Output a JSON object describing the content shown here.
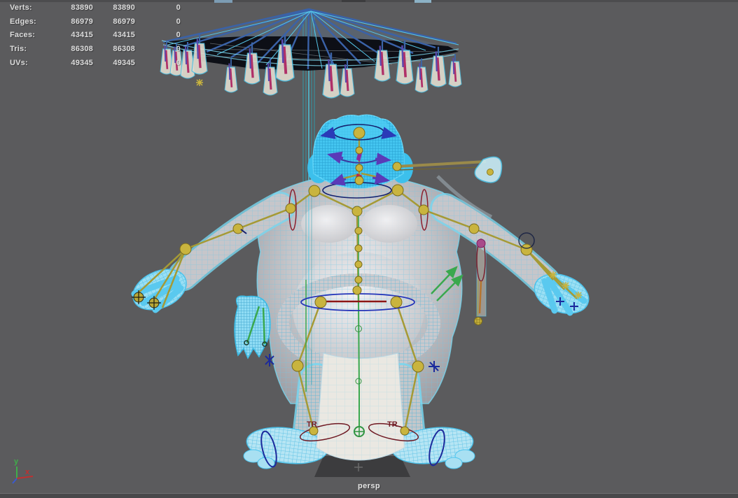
{
  "app": {
    "viewport_camera_label": "persp"
  },
  "hud": {
    "rows": [
      {
        "label": "Verts:",
        "values": [
          "83890",
          "83890",
          "0"
        ]
      },
      {
        "label": "Edges:",
        "values": [
          "86979",
          "86979",
          "0"
        ]
      },
      {
        "label": "Faces:",
        "values": [
          "43415",
          "43415",
          "0"
        ]
      },
      {
        "label": "Tris:",
        "values": [
          "86308",
          "86308",
          "0"
        ]
      },
      {
        "label": "UVs:",
        "values": [
          "49345",
          "49345",
          "0"
        ]
      }
    ]
  },
  "axis_gizmo": {
    "y_label": "y",
    "x_label": "x"
  },
  "rig": {
    "left_foot_label": "TR",
    "right_foot_label": "TR"
  },
  "colors": {
    "background": "#5b5b5d",
    "hud_text": "#dcdcdc",
    "wire_cyan": "#3cc6f0",
    "smooth_gray": "#c6c6ca",
    "joint_yellow": "#c9b43e",
    "bone_olive": "#a59a35",
    "spine_green": "#3aa84e",
    "control_navy": "#1c2a8c",
    "control_maroon": "#7a1c28",
    "umbrella_rib_blue": "#3a62a8",
    "tassel_cream": "#e0dbce",
    "accent_magenta": "#b03068",
    "pipe_khaki": "#9a8a4a",
    "axis_y_green": "#3fae4a",
    "axis_x_red": "#c03030"
  }
}
